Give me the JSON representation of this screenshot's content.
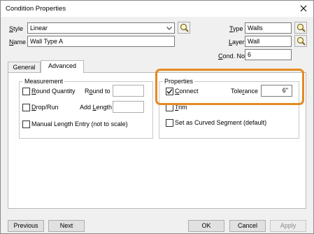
{
  "window": {
    "title": "Condition Properties"
  },
  "fields": {
    "style": {
      "label_u": "S",
      "label_rest": "tyle",
      "value": "Linear"
    },
    "name": {
      "label_u": "N",
      "label_rest": "ame",
      "value": "Wall Type A"
    },
    "type": {
      "label_u": "T",
      "label_rest": "ype",
      "value": "Walls"
    },
    "layer": {
      "label_u": "L",
      "label_rest": "ayer",
      "value": "Wall"
    },
    "cond_no": {
      "label_u": "C",
      "label_rest": "ond. No.",
      "value": "6"
    }
  },
  "tabs": [
    {
      "label": "General"
    },
    {
      "label": "Advanced"
    }
  ],
  "active_tab": "Advanced",
  "measurement": {
    "title": "Measurement",
    "round_quantity": {
      "label_u": "R",
      "label_rest": "ound Quantity",
      "checked": false
    },
    "round_to": {
      "label_pre": "R",
      "label_u": "o",
      "label_rest": "und to",
      "value": ""
    },
    "drop_run": {
      "label_u": "D",
      "label_rest": "rop/Run",
      "checked": false
    },
    "add_length": {
      "label_pre": "Add ",
      "label_u": "L",
      "label_rest": "ength",
      "value": ""
    },
    "manual_length": {
      "label": "Manual Length Entry (not to scale)",
      "checked": false
    }
  },
  "properties": {
    "title": "Properties",
    "connect": {
      "label_u": "C",
      "label_rest": "onnect",
      "checked": true
    },
    "tolerance": {
      "label_pre": "Tole",
      "label_u": "r",
      "label_rest": "ance",
      "value": "6\""
    },
    "trim": {
      "label_u": "T",
      "label_rest": "rim",
      "checked": false
    },
    "curved": {
      "label": "Set as Curved Segment (default)",
      "checked": false
    }
  },
  "buttons": {
    "previous": "Previous",
    "next": "Next",
    "ok": "OK",
    "cancel": "Cancel",
    "apply": "Apply"
  },
  "colors": {
    "highlight": "#e38a21"
  }
}
